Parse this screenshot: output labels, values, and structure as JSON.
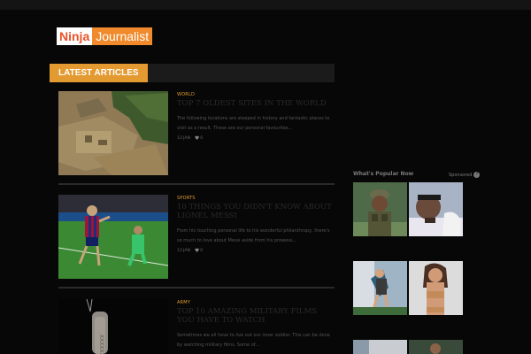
{
  "site": {
    "logo_part1": "Ninja",
    "logo_part2": "Journalist"
  },
  "section": {
    "title": "LATEST ARTICLES"
  },
  "articles": [
    {
      "category": "WORLD",
      "title": "TOP 7 OLDEST SITES IN THE WORLD",
      "excerpt": "The following locations are steeped in history and fantastic places to visit as a result. These are our personal favourites...",
      "date": "13 JAN",
      "likes": "0"
    },
    {
      "category": "SPORTS",
      "title": "10 THINGS YOU DIDN'T KNOW ABOUT LIONEL MESSI",
      "excerpt": "From his touching personal life to his wonderful philanthropy, there's so much to love about Messi aside from his prowess...",
      "date": "13 JAN",
      "likes": "0"
    },
    {
      "category": "ARMY",
      "title": "TOP 10 AMAZING MILITARY FILMS YOU HAVE TO WATCH",
      "excerpt": "Sometimes we all have to live out our inner soldier. This can be done by watching military films. Some of...",
      "date": "",
      "likes": ""
    }
  ],
  "popular": {
    "title": "What's Popular Now",
    "sponsored": "Sponsored",
    "info_glyph": "?"
  },
  "icons": {
    "like": "heart-icon",
    "info": "question-circle-icon"
  },
  "colors": {
    "accent": "#e39a31",
    "background": "#070707",
    "logo_orange": "#f08a2c"
  }
}
